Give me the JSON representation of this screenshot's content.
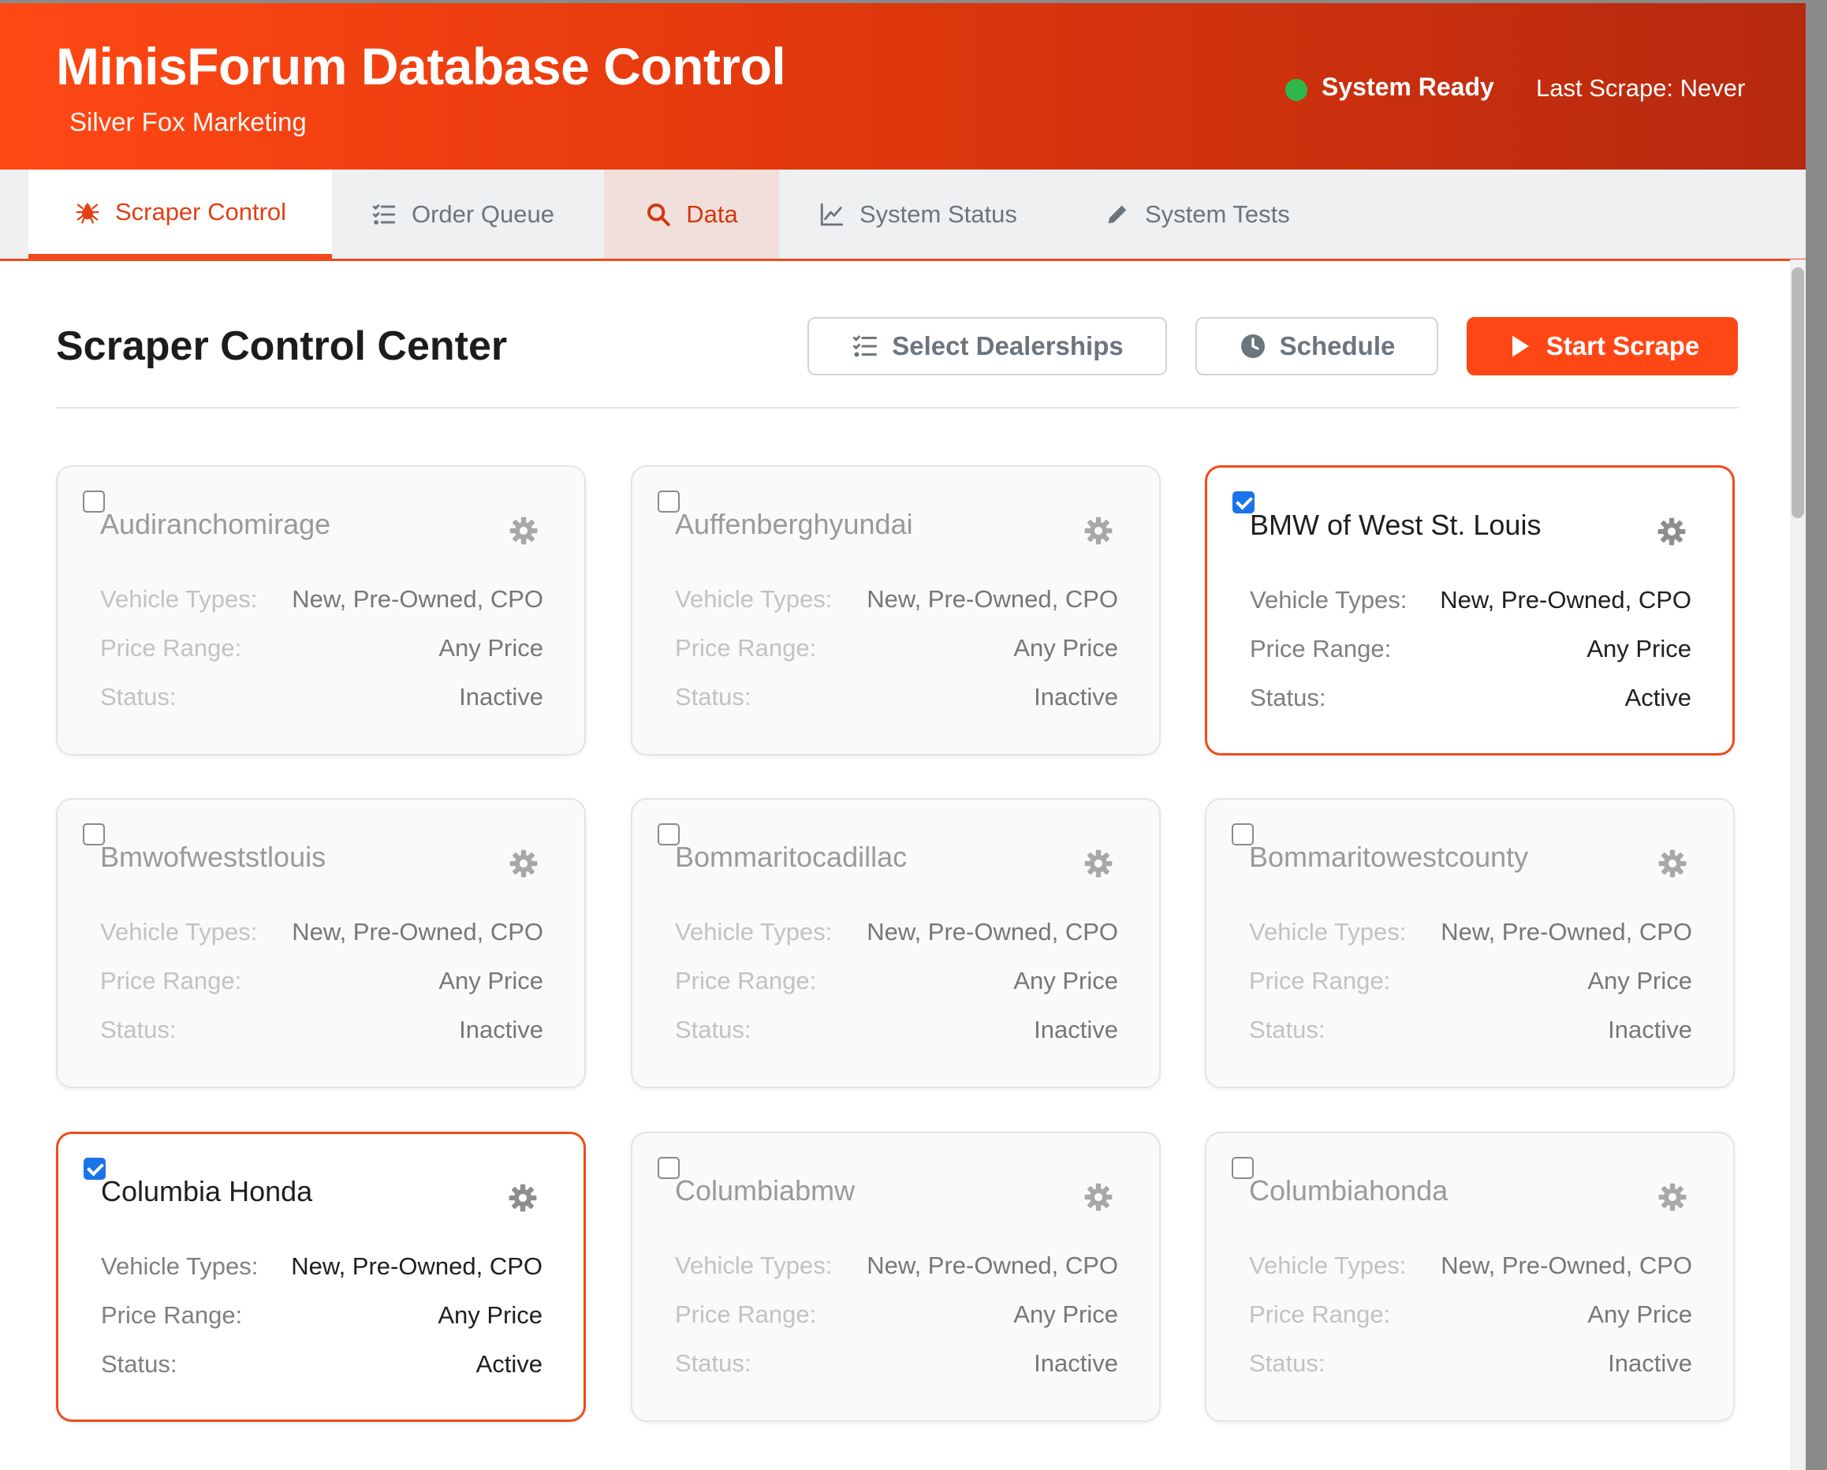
{
  "header": {
    "title": "MinisForum Database Control",
    "subtitle": "Silver Fox Marketing",
    "status": "System Ready",
    "last_scrape": "Last Scrape: Never"
  },
  "tabs": [
    {
      "label": "Scraper Control",
      "icon": "spider-icon"
    },
    {
      "label": "Order Queue",
      "icon": "list-check-icon"
    },
    {
      "label": "Data",
      "icon": "search-icon"
    },
    {
      "label": "System Status",
      "icon": "chart-line-icon"
    },
    {
      "label": "System Tests",
      "icon": "pencil-icon"
    }
  ],
  "main": {
    "title": "Scraper Control Center",
    "buttons": {
      "select_dealerships": "Select Dealerships",
      "schedule": "Schedule",
      "start_scrape": "Start Scrape"
    }
  },
  "labels": {
    "vehicle_types": "Vehicle Types:",
    "price_range": "Price Range:",
    "status": "Status:"
  },
  "dealers": [
    {
      "name": "Audiranchomirage",
      "vehicle_types": "New, Pre-Owned, CPO",
      "price_range": "Any Price",
      "status": "Inactive",
      "checked": false
    },
    {
      "name": "Auffenberghyundai",
      "vehicle_types": "New, Pre-Owned, CPO",
      "price_range": "Any Price",
      "status": "Inactive",
      "checked": false
    },
    {
      "name": "BMW of West St. Louis",
      "vehicle_types": "New, Pre-Owned, CPO",
      "price_range": "Any Price",
      "status": "Active",
      "checked": true
    },
    {
      "name": "Bmwofweststlouis",
      "vehicle_types": "New, Pre-Owned, CPO",
      "price_range": "Any Price",
      "status": "Inactive",
      "checked": false
    },
    {
      "name": "Bommaritocadillac",
      "vehicle_types": "New, Pre-Owned, CPO",
      "price_range": "Any Price",
      "status": "Inactive",
      "checked": false
    },
    {
      "name": "Bommaritowestcounty",
      "vehicle_types": "New, Pre-Owned, CPO",
      "price_range": "Any Price",
      "status": "Inactive",
      "checked": false
    },
    {
      "name": "Columbia Honda",
      "vehicle_types": "New, Pre-Owned, CPO",
      "price_range": "Any Price",
      "status": "Active",
      "checked": true
    },
    {
      "name": "Columbiabmw",
      "vehicle_types": "New, Pre-Owned, CPO",
      "price_range": "Any Price",
      "status": "Inactive",
      "checked": false
    },
    {
      "name": "Columbiahonda",
      "vehicle_types": "New, Pre-Owned, CPO",
      "price_range": "Any Price",
      "status": "Inactive",
      "checked": false
    }
  ],
  "colors": {
    "accent": "#ff4716",
    "header_start": "#ff4814",
    "header_end": "#b6290f",
    "status_ready": "#2fb84a",
    "checkbox_checked": "#1a73e8"
  }
}
